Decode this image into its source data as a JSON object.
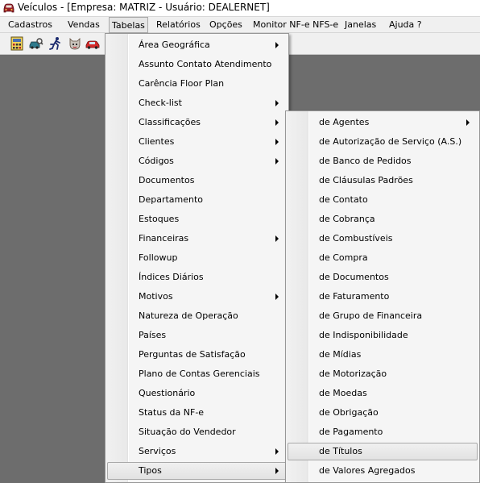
{
  "window": {
    "title": "Veículos - [Empresa: MATRIZ - Usuário: DEALERNET]",
    "icon": "car-app-icon"
  },
  "menubar": {
    "items": [
      {
        "label": "Cadastros"
      },
      {
        "label": "Vendas"
      },
      {
        "label": "Tabelas",
        "active": true
      },
      {
        "label": "Relatórios"
      },
      {
        "label": "Opções"
      },
      {
        "label": "Monitor NF-e NFS-e"
      },
      {
        "label": "Janelas"
      },
      {
        "label": "Ajuda ?"
      }
    ]
  },
  "toolbar": {
    "buttons": [
      {
        "icon": "calculator-icon"
      },
      {
        "icon": "car-search-icon"
      },
      {
        "icon": "running-person-icon"
      },
      {
        "icon": "dog-mascot-icon"
      },
      {
        "icon": "red-car-icon"
      }
    ]
  },
  "tabelas_menu": {
    "items": [
      {
        "label": "Área Geográfica",
        "submenu": true
      },
      {
        "label": "Assunto Contato Atendimento",
        "submenu": false
      },
      {
        "label": "Carência Floor Plan",
        "submenu": false
      },
      {
        "label": "Check-list",
        "submenu": true
      },
      {
        "label": "Classificações",
        "submenu": true
      },
      {
        "label": "Clientes",
        "submenu": true
      },
      {
        "label": "Códigos",
        "submenu": true
      },
      {
        "label": "Documentos",
        "submenu": false
      },
      {
        "label": "Departamento",
        "submenu": false
      },
      {
        "label": "Estoques",
        "submenu": false
      },
      {
        "label": "Financeiras",
        "submenu": true
      },
      {
        "label": "Followup",
        "submenu": false
      },
      {
        "label": "Índices Diários",
        "submenu": false
      },
      {
        "label": "Motivos",
        "submenu": true
      },
      {
        "label": "Natureza de Operação",
        "submenu": false
      },
      {
        "label": "Países",
        "submenu": false
      },
      {
        "label": "Perguntas de Satisfação",
        "submenu": false
      },
      {
        "label": "Plano de Contas Gerenciais",
        "submenu": false
      },
      {
        "label": "Questionário",
        "submenu": false
      },
      {
        "label": "Status da NF-e",
        "submenu": false
      },
      {
        "label": "Situação do Vendedor",
        "submenu": false
      },
      {
        "label": "Serviços",
        "submenu": true
      },
      {
        "label": "Tipos",
        "submenu": true,
        "highlighted": true
      }
    ]
  },
  "tipos_submenu": {
    "items": [
      {
        "label": "de Agentes",
        "submenu": true
      },
      {
        "label": "de Autorização de Serviço (A.S.)",
        "submenu": false
      },
      {
        "label": "de Banco de Pedidos",
        "submenu": false
      },
      {
        "label": "de Cláusulas Padrões",
        "submenu": false
      },
      {
        "label": "de Contato",
        "submenu": false
      },
      {
        "label": "de Cobrança",
        "submenu": false
      },
      {
        "label": "de Combustíveis",
        "submenu": false
      },
      {
        "label": "de Compra",
        "submenu": false
      },
      {
        "label": "de Documentos",
        "submenu": false
      },
      {
        "label": "de Faturamento",
        "submenu": false
      },
      {
        "label": "de Grupo de Financeira",
        "submenu": false
      },
      {
        "label": "de Indisponibilidade",
        "submenu": false
      },
      {
        "label": "de Mídias",
        "submenu": false
      },
      {
        "label": "de Motorização",
        "submenu": false
      },
      {
        "label": "de Moedas",
        "submenu": false
      },
      {
        "label": "de Obrigação",
        "submenu": false
      },
      {
        "label": "de Pagamento",
        "submenu": false
      },
      {
        "label": "de Títulos",
        "submenu": false,
        "highlighted": true
      },
      {
        "label": "de Valores Agregados",
        "submenu": false
      }
    ]
  },
  "colors": {
    "workspace": "#6d6d6d",
    "menu_background": "#f5f5f5",
    "menu_border": "#979797"
  }
}
